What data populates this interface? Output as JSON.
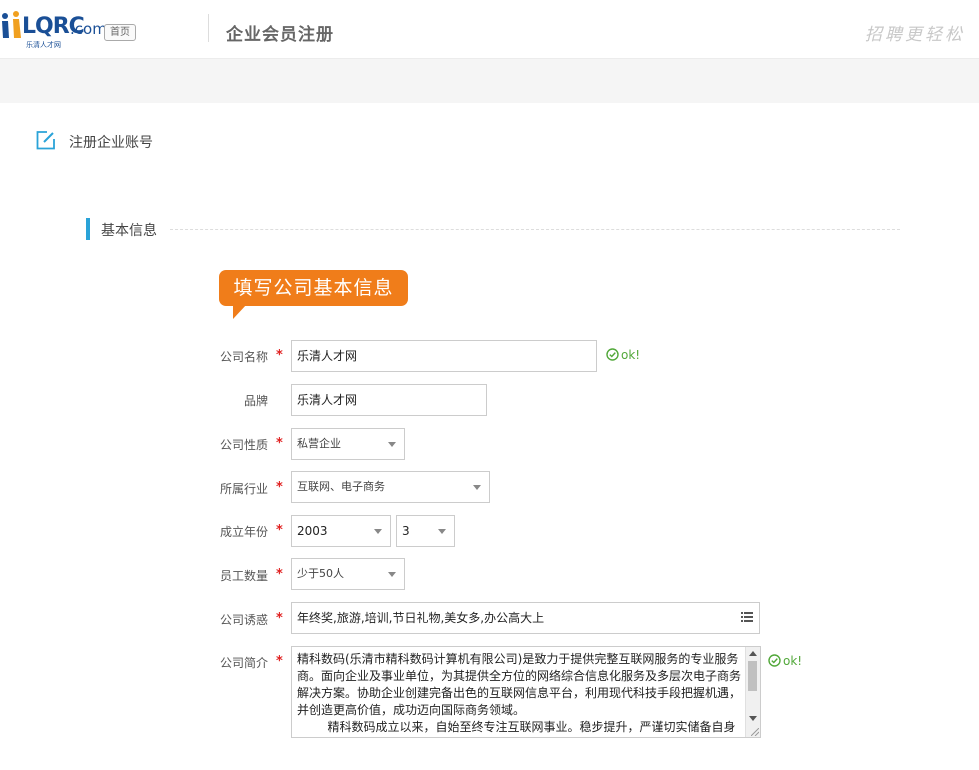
{
  "header": {
    "logo_main": "LQRC",
    "logo_com": ".com",
    "logo_sub": "乐清人才网",
    "home_tag": "首页",
    "page_title": "企业会员注册",
    "slogan": "招聘更轻松"
  },
  "register_heading": "注册企业账号",
  "section_title": "基本信息",
  "bubble_text": "填写公司基本信息",
  "form": {
    "company_name": {
      "label": "公司名称",
      "value": "乐清人才网",
      "status": "ok!"
    },
    "brand": {
      "label": "品牌",
      "value": "乐清人才网"
    },
    "nature": {
      "label": "公司性质",
      "value": "私营企业"
    },
    "industry": {
      "label": "所属行业",
      "value": "互联网、电子商务"
    },
    "founded": {
      "label": "成立年份",
      "year": "2003",
      "month": "3"
    },
    "employees": {
      "label": "员工数量",
      "value": "少于50人"
    },
    "attraction": {
      "label": "公司诱惑",
      "value": "年终奖,旅游,培训,节日礼物,美女多,办公高大上"
    },
    "intro": {
      "label": "公司简介",
      "status": "ok!",
      "value": "精科数码(乐清市精科数码计算机有限公司)是致力于提供完整互联网服务的专业服务商。面向企业及事业单位，为其提供全方位的网络综合信息化服务及多层次电子商务解决方案。协助企业创建完备出色的互联网信息平台，利用现代科技手段把握机遇，并创造更高价值，成功迈向国际商务领域。\n        精科数码成立以来，自始至终专注互联网事业。稳步提升，严谨切实储备自身"
    }
  },
  "colors": {
    "accent": "#2aa3d8",
    "bubble": "#f07d1a",
    "ok": "#52a83a",
    "required": "#e02020"
  }
}
